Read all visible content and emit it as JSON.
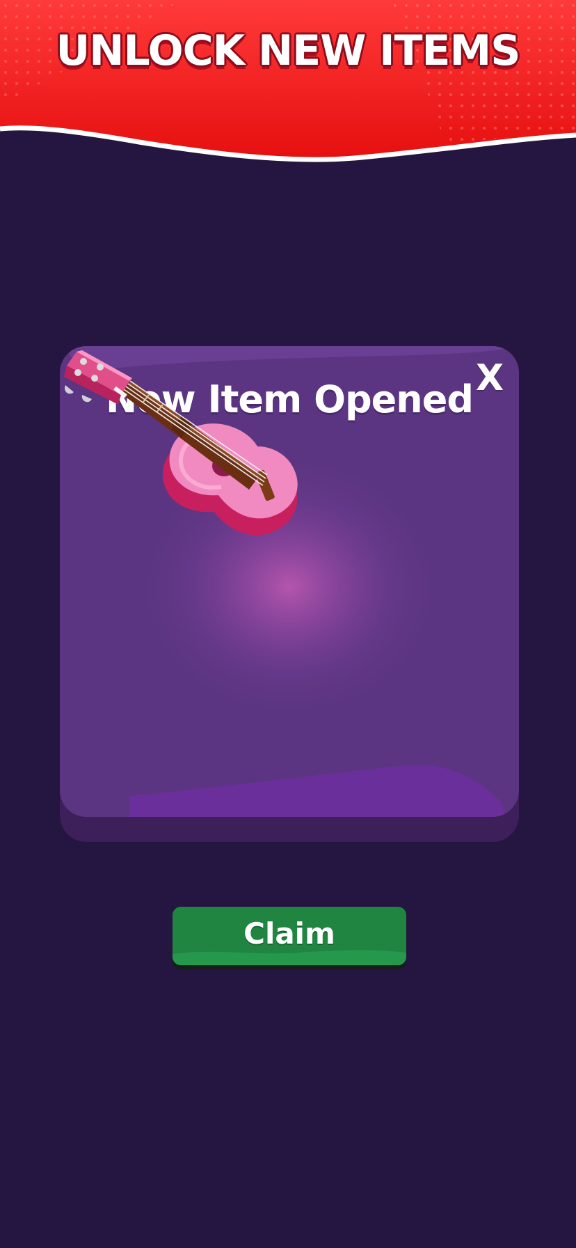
{
  "header": {
    "title": "UNLOCK NEW ITEMS",
    "color": "#f01c1c"
  },
  "modal": {
    "title": "New Item Opened",
    "close_label": "X",
    "item": {
      "name": "ukulele",
      "icon": "ukulele-icon",
      "color": "#e8528f"
    },
    "colors": {
      "face": "#5b3581",
      "base": "#3d1f59"
    }
  },
  "claim_button": {
    "label": "Claim",
    "color": "#1f8541"
  },
  "colors": {
    "background": "#241640"
  }
}
